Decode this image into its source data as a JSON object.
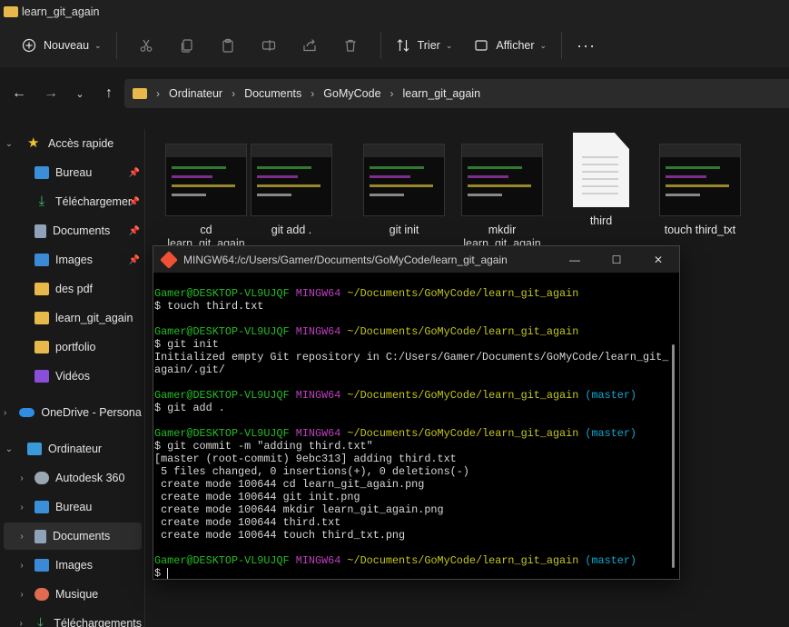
{
  "window": {
    "title": "learn_git_again"
  },
  "toolbar": {
    "new_label": "Nouveau",
    "sort_label": "Trier",
    "view_label": "Afficher"
  },
  "breadcrumb": [
    "Ordinateur",
    "Documents",
    "GoMyCode",
    "learn_git_again"
  ],
  "sidebar": {
    "quick_access": "Accès rapide",
    "quick_items": [
      {
        "label": "Bureau",
        "pinned": true
      },
      {
        "label": "Téléchargements",
        "pinned": true
      },
      {
        "label": "Documents",
        "pinned": true
      },
      {
        "label": "Images",
        "pinned": true
      },
      {
        "label": "des pdf",
        "pinned": false
      },
      {
        "label": "learn_git_again",
        "pinned": false
      },
      {
        "label": "portfolio",
        "pinned": false
      },
      {
        "label": "Vidéos",
        "pinned": false
      }
    ],
    "onedrive": "OneDrive - Personal",
    "computer": "Ordinateur",
    "computer_items": [
      "Autodesk 360",
      "Bureau",
      "Documents",
      "Images",
      "Musique",
      "Téléchargements"
    ]
  },
  "files": [
    {
      "name_line1": "cd",
      "name_line2": "learn_git_again",
      "type": "image"
    },
    {
      "name_line1": "git add .",
      "name_line2": "",
      "type": "image"
    },
    {
      "name_line1": "git init",
      "name_line2": "",
      "type": "image"
    },
    {
      "name_line1": "mkdir",
      "name_line2": "learn_git_again",
      "type": "image"
    },
    {
      "name_line1": "third",
      "name_line2": "",
      "type": "text"
    },
    {
      "name_line1": "touch third_txt",
      "name_line2": "",
      "type": "image"
    }
  ],
  "terminal": {
    "title": "MINGW64:/c/Users/Gamer/Documents/GoMyCode/learn_git_again",
    "user_host": "Gamer@DESKTOP-VL9UJQF",
    "shell": "MINGW64",
    "path": "~/Documents/GoMyCode/learn_git_again",
    "branch": "(master)",
    "cmd1": "$ touch third.txt",
    "cmd2": "$ git init",
    "out2a": "Initialized empty Git repository in C:/Users/Gamer/Documents/GoMyCode/learn_git_",
    "out2b": "again/.git/",
    "cmd3": "$ git add .",
    "cmd4": "$ git commit -m \"adding third.txt\"",
    "out4": [
      "[master (root-commit) 9ebc313] adding third.txt",
      " 5 files changed, 0 insertions(+), 0 deletions(-)",
      " create mode 100644 cd learn_git_again.png",
      " create mode 100644 git init.png",
      " create mode 100644 mkdir learn_git_again.png",
      " create mode 100644 third.txt",
      " create mode 100644 touch third_txt.png"
    ],
    "prompt": "$ "
  },
  "colors": {
    "folder": "#e8b94a",
    "term_green": "#25bc24",
    "term_magenta": "#bc3fbc",
    "term_yellow": "#c6c61d",
    "term_cyan": "#11a8cd"
  }
}
